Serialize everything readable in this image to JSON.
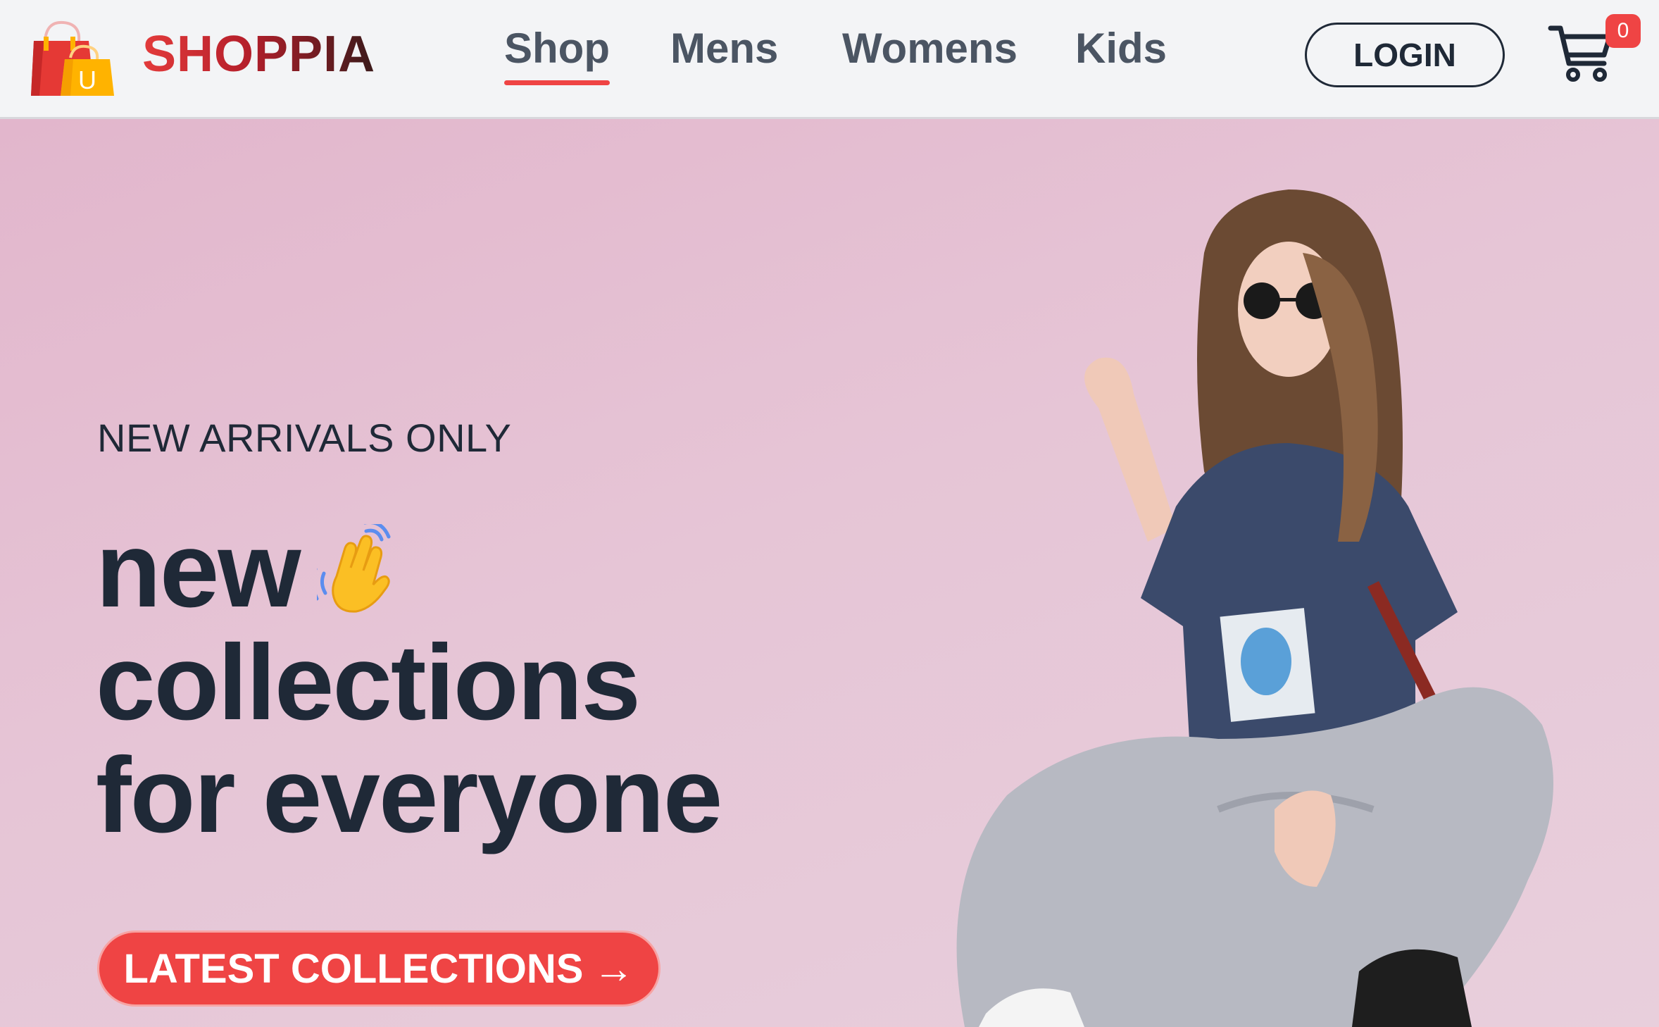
{
  "header": {
    "brand": "SHOPPIA",
    "logo_letter": "U",
    "nav": [
      {
        "label": "Shop",
        "active": true
      },
      {
        "label": "Mens",
        "active": false
      },
      {
        "label": "Womens",
        "active": false
      },
      {
        "label": "Kids",
        "active": false
      }
    ],
    "login_label": "LOGIN",
    "cart_count": "0"
  },
  "hero": {
    "eyebrow": "NEW ARRIVALS ONLY",
    "headline": [
      "new",
      "collections",
      "for everyone"
    ],
    "cta_label": "LATEST COLLECTIONS",
    "cta_arrow": "→"
  },
  "icons": {
    "logo": "shopping-bags-icon",
    "cart": "cart-icon",
    "wave": "waving-hand-icon",
    "arrow": "arrow-right-icon"
  },
  "colors": {
    "accent": "#ef4444",
    "text_dark": "#1f2937",
    "nav_text": "#4b5563",
    "hero_bg": "#e5c3d4",
    "header_bg": "#f3f4f6"
  }
}
